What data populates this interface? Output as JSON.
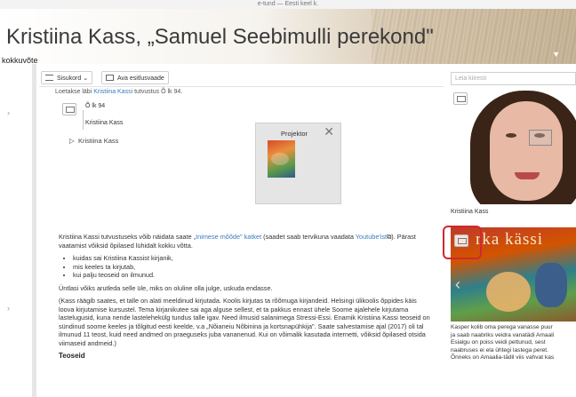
{
  "topbar": {
    "text": "e-tund — Eesti keel k."
  },
  "header": {
    "title": "Kristiina Kass, „Samuel Seebimulli perekond\"",
    "subtitle": "kokkuvõte"
  },
  "toolbar": {
    "contents_label": "Sisukord",
    "contents_chevron": "⌄",
    "presentation_label": "Ava esitlusvaade",
    "search_placeholder": "Leia kiiresti"
  },
  "resource": {
    "cut_text_before": "Loetakse läbi ",
    "cut_link": "Kristiina Kassi",
    "cut_text_after": " tutvustus Õ lk 94.",
    "page_ref": "Õ lk 94",
    "author": "Kristiina Kass",
    "tree_item": "Kristiina Kass"
  },
  "projector_popup": {
    "title": "Projektor",
    "close": "✕"
  },
  "content": {
    "intro_before": "Kristiina Kassi tutvustuseks võib näidata saate ",
    "intro_link": "„Inimese mõõde\" katket",
    "intro_middle": " (saadet saab tervikuna vaadata ",
    "intro_link2": "Youtube'ist",
    "intro_after": "). Pärast vaatamist võiksid õpilased lühidalt kokku võtta.",
    "bullets": [
      "kuidas sai Kristiina Kassist kirjanik,",
      "mis keeles ta kirjutab,",
      "kui palju teoseid on ilmunud."
    ],
    "para2": "Üntlasi võiks arutleda selle üle, miks on oluline olla julge, uskuda endasse.",
    "para3": "(Kass räägib saates, et talle on alati meeldinud kirjutada. Koolis kirjutas ta rõõmuga kirjandeid. Helsingi ülikoolis õppides käis loova kirjutamise kursustel. Tema kirjanikutee sai aga alguse sellest, et ta pakkus ennast ühele Soome ajalehele kirjutama lastelugusid, kuna nende lastelehekülg tundus talle igav. Need ilmusid salanimega Stressi-Essi. Enamik Kristiina Kassi teoseid on sündinud soome keeles ja tõlgitud eesti keelde, v.a „Nõianeiu Nõbinina ja kortsnapühkija\". Saate salvestamise ajal (2017) oli tal ilmunud 11 teost, kuid need andmed on praeguseks juba vananenud. Kui on võimalik kasutada internetti, võiksid õpilased otsida viimaseid andmeid.)",
    "heading": "Teoseid"
  },
  "sidebar": {
    "photo_caption": "Kristiina Kass",
    "book_title": "rka kässi",
    "book_desc": [
      "Kasper kolib oma perega vanasse puur",
      "ja saab naabriks veidra vanatädi Amaali",
      "Esialgu on poiss veidi pettunud, sest",
      "naabruses ei ela ühtegi lastega peret.",
      "Õnneks on Amaalia-tädil viis vahvat kas"
    ]
  },
  "colors": {
    "link": "#3a7bbf",
    "highlight": "#d0282d"
  }
}
